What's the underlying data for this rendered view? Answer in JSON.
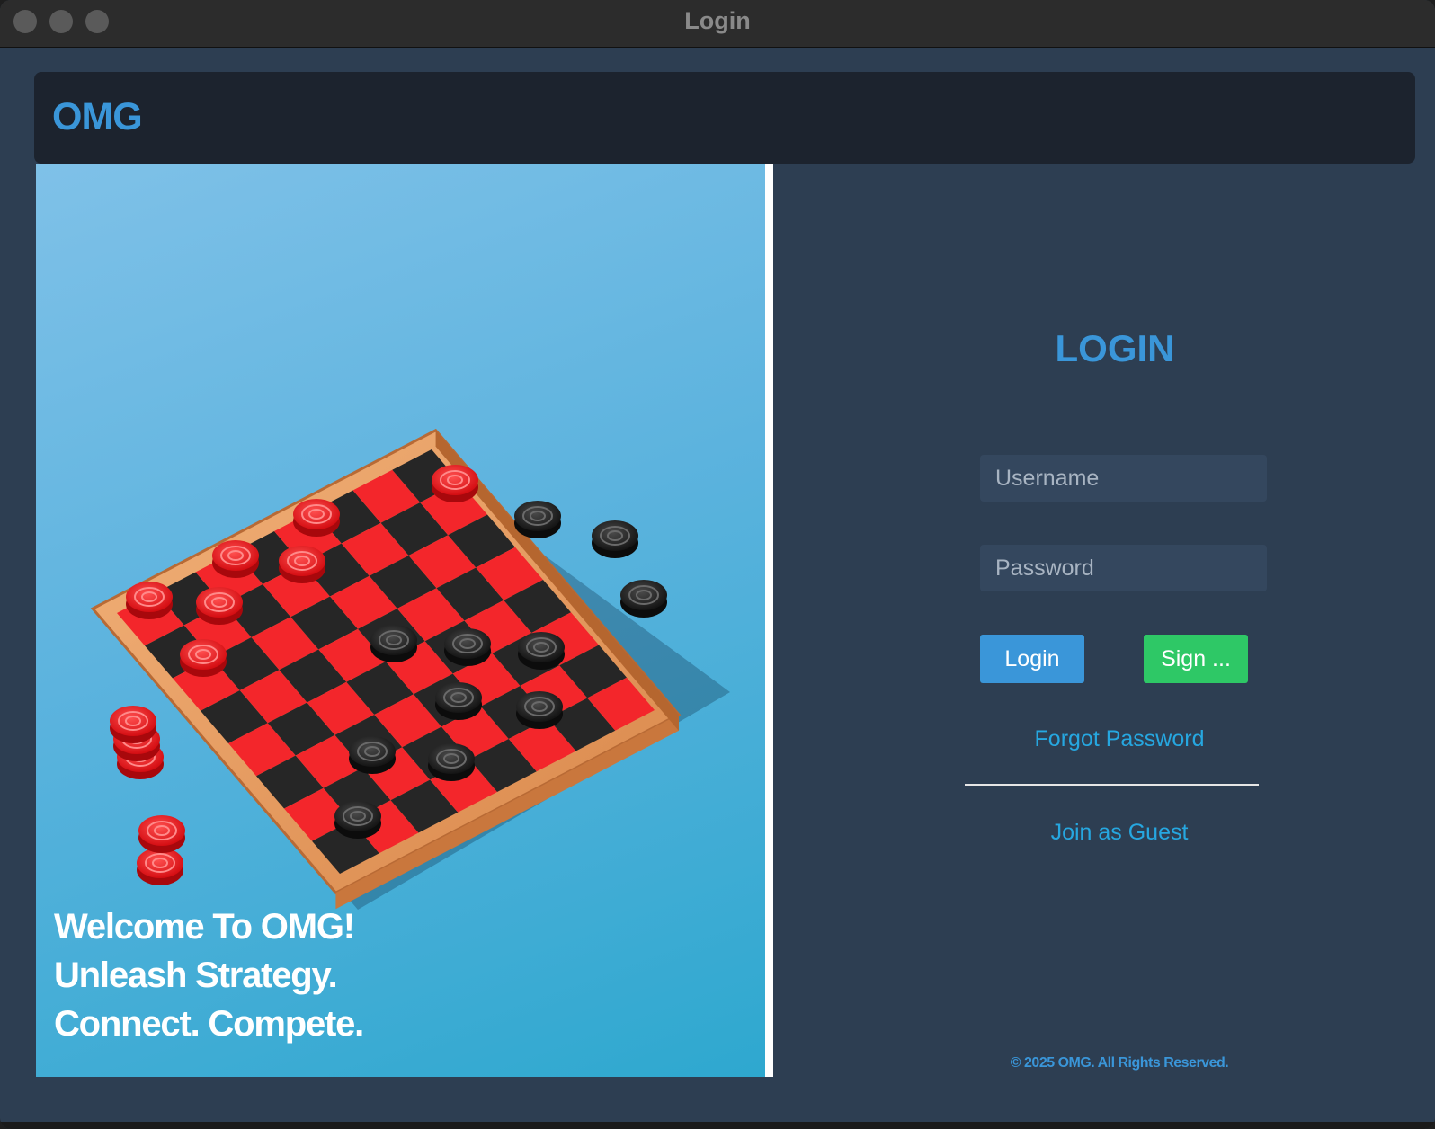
{
  "window": {
    "title": "Login"
  },
  "header": {
    "brand": "OMG"
  },
  "hero": {
    "lines": [
      "Welcome To OMG!",
      "Unleash Strategy.",
      "Connect. Compete."
    ]
  },
  "login": {
    "title": "LOGIN",
    "username_placeholder": "Username",
    "password_placeholder": "Password",
    "login_label": "Login",
    "signup_label": "Sign ...",
    "forgot_label": "Forgot Password",
    "guest_label": "Join as Guest"
  },
  "footer": {
    "copyright": "© 2025 OMG. All Rights Reserved."
  },
  "colors": {
    "accent": "#3a96d9",
    "signup": "#2ec866",
    "link": "#26a7e0",
    "panel": "#2d3e52",
    "header": "#1c232e"
  }
}
